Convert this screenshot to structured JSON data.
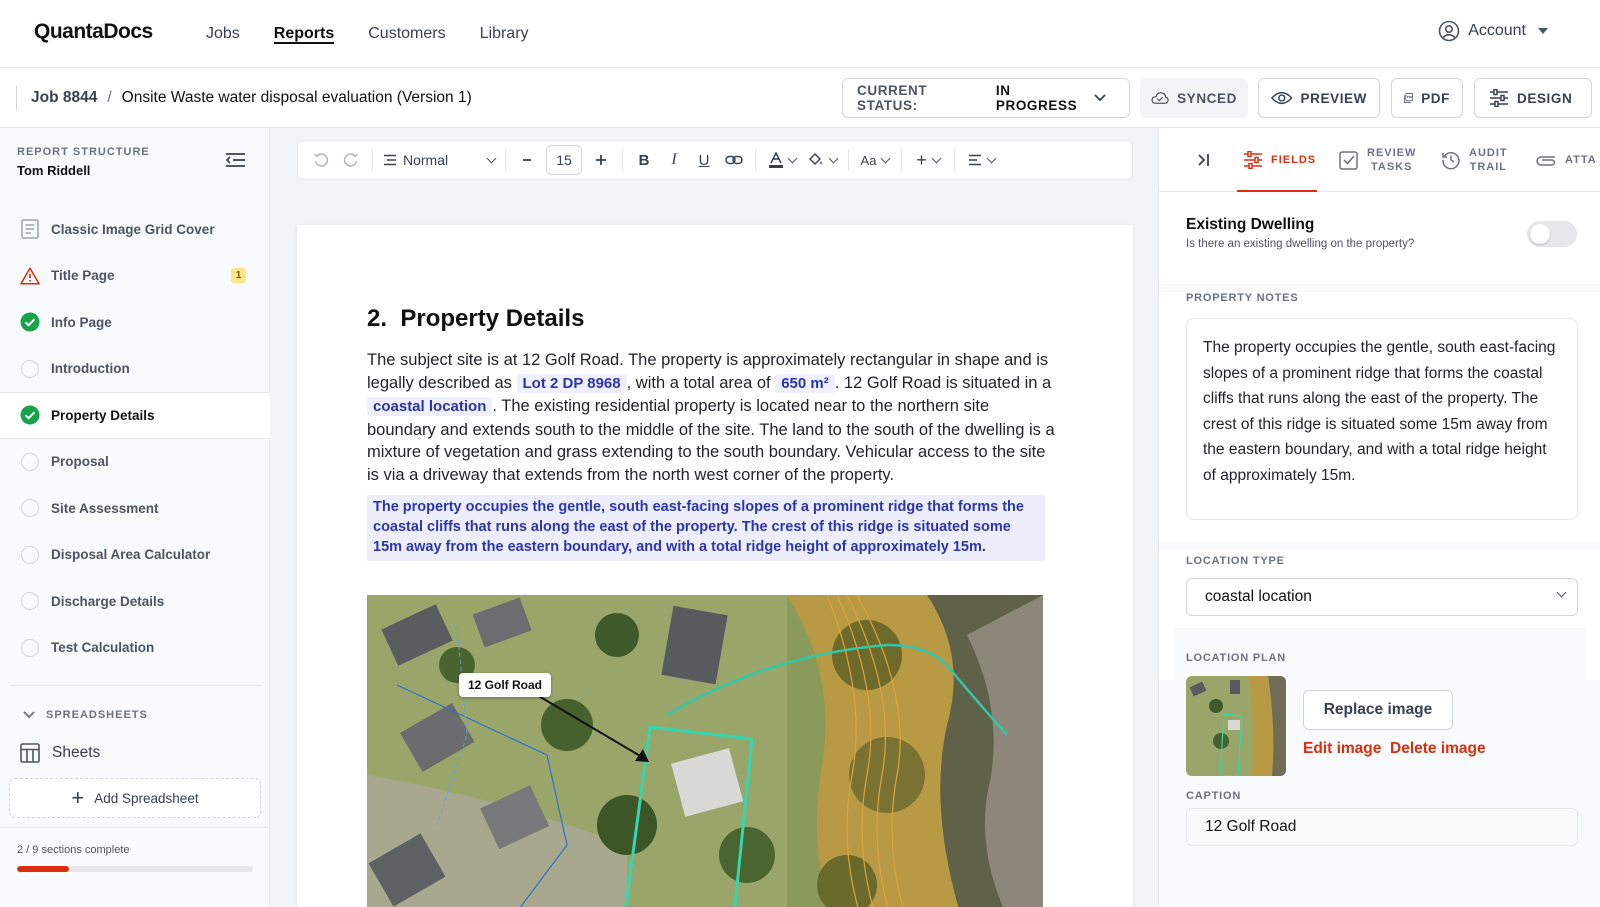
{
  "app": {
    "logo": "QuantaDocs"
  },
  "nav": {
    "links": [
      "Jobs",
      "Reports",
      "Customers",
      "Library"
    ],
    "active": "Reports",
    "account_label": "Account"
  },
  "jobbar": {
    "job": "Job 8844",
    "separator": "/",
    "title": "Onsite Waste water disposal evaluation (Version 1)",
    "status_label": "CURRENT STATUS:",
    "status_value": "IN PROGRESS",
    "synced": "SYNCED",
    "preview": "PREVIEW",
    "pdf": "PDF",
    "design": "DESIGN"
  },
  "sidebar": {
    "heading": "REPORT STRUCTURE",
    "author": "Tom Riddell",
    "items": [
      {
        "label": "Classic Image Grid Cover",
        "state": "doc"
      },
      {
        "label": "Title Page",
        "state": "warning",
        "badge": "1"
      },
      {
        "label": "Info Page",
        "state": "complete"
      },
      {
        "label": "Introduction",
        "state": "empty"
      },
      {
        "label": "Property Details",
        "state": "complete",
        "active": true
      },
      {
        "label": "Proposal",
        "state": "empty"
      },
      {
        "label": "Site Assessment",
        "state": "empty"
      },
      {
        "label": "Disposal Area Calculator",
        "state": "empty"
      },
      {
        "label": "Discharge Details",
        "state": "empty"
      },
      {
        "label": "Test Calculation",
        "state": "empty"
      }
    ],
    "spreadsheets_heading": "SPREADSHEETS",
    "sheets_label": "Sheets",
    "add_spreadsheet": "Add Spreadsheet",
    "progress_text": "2 / 9 sections complete",
    "progress_fraction": 0.222
  },
  "toolbar": {
    "style": "Normal",
    "font_size": "15",
    "case_label": "Aa",
    "insert_label": "+"
  },
  "document": {
    "section_number": "2.",
    "section_title": "Property Details",
    "p1_a": "The subject site is at 12 Golf Road. The property is approximately rectangular in shape and is legally described as ",
    "chip_lot": "Lot 2 DP 8968",
    "p1_b": ", with a total area of ",
    "chip_area": "650 m²",
    "p1_c": ". 12 Golf Road is situated in a ",
    "chip_location": "coastal location",
    "p1_d": ". The existing residential property is located near to the northern site boundary and extends south to the middle of the site. The land to the south of the dwelling is a mixture of vegetation and grass extending to the south boundary. Vehicular access to the site is via a driveway that extends from the north west corner of the property.",
    "highlight": "The property occupies the gentle, south east-facing slopes of a prominent ridge that forms the coastal cliffs that runs along the east of the property. The crest of this ridge is situated some 15m away from the eastern boundary, and with a total ridge height of approximately 15m.",
    "map_label": "12 Golf Road"
  },
  "rpanel": {
    "tabs": {
      "fields": "FIELDS",
      "review_1": "REVIEW",
      "review_2": "TASKS",
      "audit_1": "AUDIT",
      "audit_2": "TRAIL",
      "attachments": "ATTA"
    },
    "dwelling_title": "Existing Dwelling",
    "dwelling_sub": "Is there an existing dwelling on the property?",
    "dwelling_on": false,
    "notes_label": "PROPERTY NOTES",
    "notes_value": "The property occupies the gentle, south east-facing slopes of a prominent ridge that forms the coastal cliffs that runs along the east of the property. The crest of this ridge is situated some 15m away from the eastern boundary, and with a total ridge height of approximately 15m.",
    "location_type_label": "LOCATION TYPE",
    "location_type_value": "coastal location",
    "location_plan_label": "LOCATION PLAN",
    "replace_image": "Replace image",
    "edit_image": "Edit image",
    "delete_image": "Delete image",
    "caption_label": "CAPTION",
    "caption_value": "12 Golf Road"
  },
  "colors": {
    "accent": "#dc2e0f",
    "chip_bg": "#eef0ff",
    "chip_text": "#2a35a8",
    "complete": "#16a34a"
  }
}
